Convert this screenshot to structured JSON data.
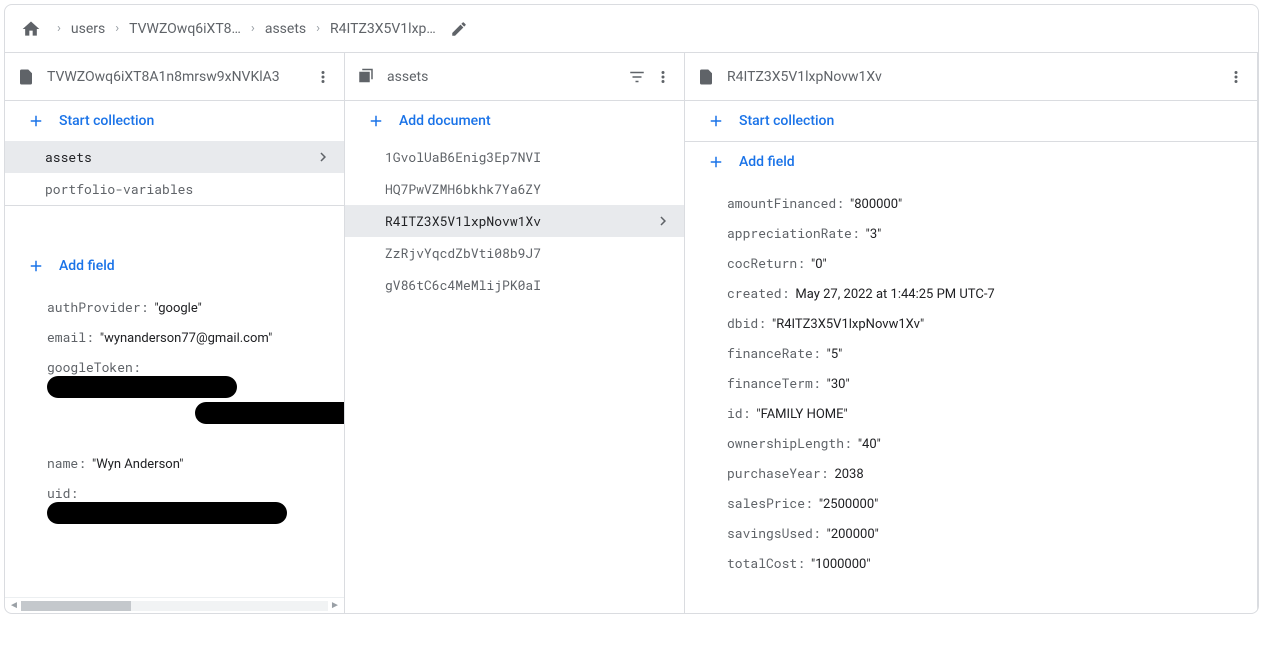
{
  "breadcrumb": {
    "items": [
      "users",
      "TVWZOwq6iXT8…",
      "assets",
      "R4ITZ3X5V1lxp…"
    ]
  },
  "panel1": {
    "title": "TVWZOwq6iXT8A1n8mrsw9xNVKlA3",
    "startCollection": "Start collection",
    "collections": {
      "c0": "assets",
      "c1": "portfolio-variables"
    },
    "addField": "Add field",
    "fields": {
      "authProvider": {
        "key": "authProvider",
        "val": "google"
      },
      "email": {
        "key": "email",
        "val": "wynanderson77@gmail.com"
      },
      "googleToken": {
        "key": "googleToken"
      },
      "name": {
        "key": "name",
        "val": "Wyn Anderson"
      },
      "uid": {
        "key": "uid"
      }
    }
  },
  "panel2": {
    "title": "assets",
    "addDocument": "Add document",
    "docs": {
      "d0": "1GvolUaB6Enig3Ep7NVI",
      "d1": "HQ7PwVZMH6bkhk7Ya6ZY",
      "d2": "R4ITZ3X5V1lxpNovw1Xv",
      "d3": "ZzRjvYqcdZbVti08b9J7",
      "d4": "gV86tC6c4MeMlijPK0aI"
    }
  },
  "panel3": {
    "title": "R4ITZ3X5V1lxpNovw1Xv",
    "startCollection": "Start collection",
    "addField": "Add field",
    "fields": {
      "amountFinanced": {
        "key": "amountFinanced",
        "val": "800000",
        "type": "str"
      },
      "appreciationRate": {
        "key": "appreciationRate",
        "val": "3",
        "type": "str"
      },
      "cocReturn": {
        "key": "cocReturn",
        "val": "0",
        "type": "str"
      },
      "created": {
        "key": "created",
        "val": "May 27, 2022 at 1:44:25 PM UTC-7",
        "type": "ts"
      },
      "dbid": {
        "key": "dbid",
        "val": "R4ITZ3X5V1lxpNovw1Xv",
        "type": "str"
      },
      "financeRate": {
        "key": "financeRate",
        "val": "5",
        "type": "str"
      },
      "financeTerm": {
        "key": "financeTerm",
        "val": "30",
        "type": "str"
      },
      "id": {
        "key": "id",
        "val": "FAMILY HOME",
        "type": "str"
      },
      "ownershipLength": {
        "key": "ownershipLength",
        "val": "40",
        "type": "str"
      },
      "purchaseYear": {
        "key": "purchaseYear",
        "val": "2038",
        "type": "num"
      },
      "salesPrice": {
        "key": "salesPrice",
        "val": "2500000",
        "type": "str"
      },
      "savingsUsed": {
        "key": "savingsUsed",
        "val": "200000",
        "type": "str"
      },
      "totalCost": {
        "key": "totalCost",
        "val": "1000000",
        "type": "str"
      }
    }
  }
}
